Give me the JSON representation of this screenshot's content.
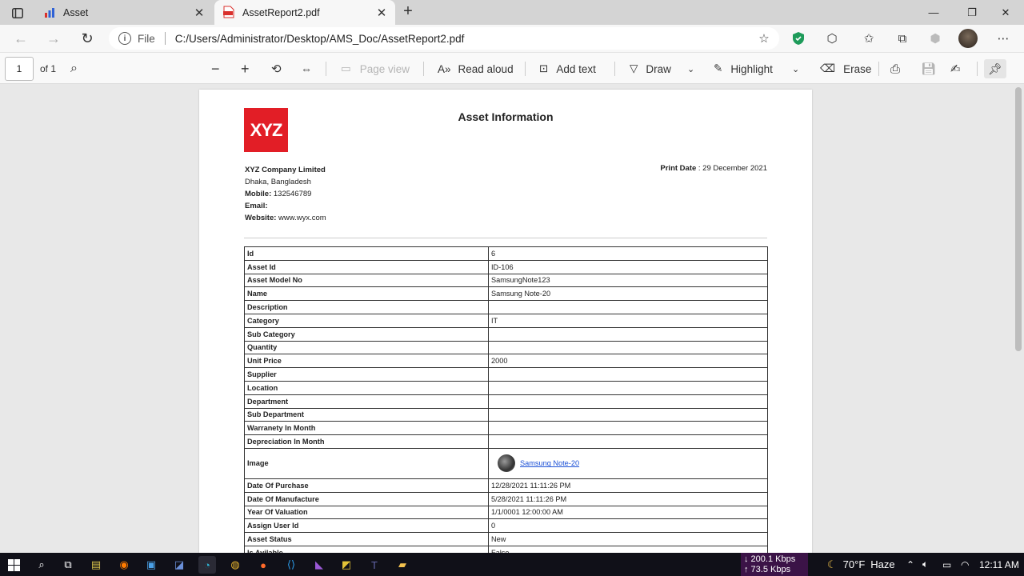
{
  "browser": {
    "tabs": [
      {
        "title": "Asset",
        "icon": "chart-favicon-icon"
      },
      {
        "title": "AssetReport2.pdf",
        "icon": "pdf-favicon-icon"
      }
    ],
    "address": {
      "scheme_label": "File",
      "url": "C:/Users/Administrator/Desktop/AMS_Doc/AssetReport2.pdf"
    }
  },
  "pdf_toolbar": {
    "page_number": "1",
    "page_total": "of 1",
    "page_view": "Page view",
    "read_aloud": "Read aloud",
    "add_text": "Add text",
    "draw": "Draw",
    "highlight": "Highlight",
    "erase": "Erase"
  },
  "document": {
    "logo_text": "XYZ",
    "title": "Asset Information",
    "company": {
      "name": "XYZ Company Limited",
      "address": "Dhaka, Bangladesh",
      "mobile_label": "Mobile:",
      "mobile": " 132546789",
      "email_label": "Email:",
      "website_label": "Website:",
      "website": " www.wyx.com"
    },
    "print_date_label": "Print Date",
    "print_date": " : 29 December 2021",
    "rows": [
      {
        "k": "Id",
        "v": "6"
      },
      {
        "k": "Asset Id",
        "v": "ID-106"
      },
      {
        "k": "Asset Model No",
        "v": "SamsungNote123"
      },
      {
        "k": "Name",
        "v": "Samsung Note-20"
      },
      {
        "k": "Description",
        "v": ""
      },
      {
        "k": "Category",
        "v": "IT"
      },
      {
        "k": "Sub Category",
        "v": ""
      },
      {
        "k": "Quantity",
        "v": ""
      },
      {
        "k": "Unit Price",
        "v": "2000"
      },
      {
        "k": "Supplier",
        "v": ""
      },
      {
        "k": "Location",
        "v": ""
      },
      {
        "k": "Department",
        "v": ""
      },
      {
        "k": "Sub Department",
        "v": ""
      },
      {
        "k": "Warranety In Month",
        "v": ""
      },
      {
        "k": "Depreciation In Month",
        "v": ""
      }
    ],
    "image_row": {
      "k": "Image",
      "link": "Samsung Note-20"
    },
    "rows2": [
      {
        "k": "Date Of Purchase",
        "v": "12/28/2021 11:11:26 PM"
      },
      {
        "k": "Date Of Manufacture",
        "v": "5/28/2021 11:11:26 PM"
      },
      {
        "k": "Year Of Valuation",
        "v": "1/1/0001 12:00:00 AM"
      },
      {
        "k": "Assign User Id",
        "v": "0"
      },
      {
        "k": "Asset Status",
        "v": "New"
      },
      {
        "k": "Is Avilable",
        "v": "False"
      }
    ]
  },
  "taskbar": {
    "net_down": "↓ 200.1 Kbps",
    "net_up": "↑ 73.5 Kbps",
    "temperature": "70°F",
    "weather": "Haze",
    "time": "12:11 AM"
  }
}
